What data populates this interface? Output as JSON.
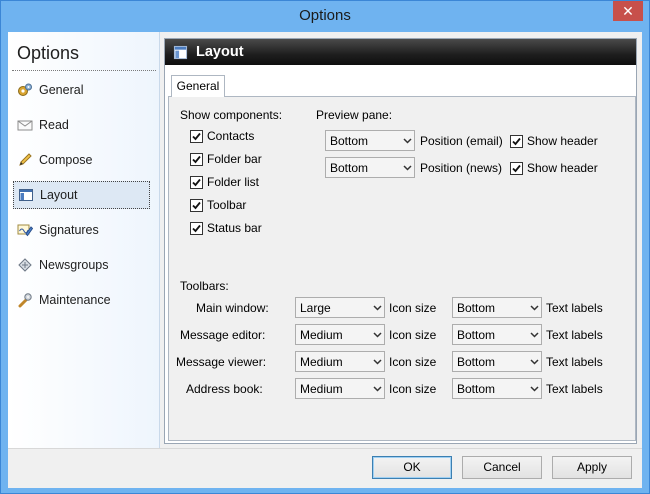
{
  "window": {
    "title": "Options",
    "close_glyph": "✕"
  },
  "sidebar": {
    "title": "Options",
    "items": [
      {
        "label": "General",
        "icon": "gears-icon"
      },
      {
        "label": "Read",
        "icon": "envelope-icon"
      },
      {
        "label": "Compose",
        "icon": "pencil-icon"
      },
      {
        "label": "Layout",
        "icon": "layout-icon",
        "selected": true
      },
      {
        "label": "Signatures",
        "icon": "signature-icon"
      },
      {
        "label": "Newsgroups",
        "icon": "newsgroups-icon"
      },
      {
        "label": "Maintenance",
        "icon": "wrench-icon"
      }
    ]
  },
  "panel": {
    "header": "Layout",
    "tab": "General",
    "show_components": {
      "label": "Show components:",
      "items": [
        {
          "label": "Contacts",
          "checked": true
        },
        {
          "label": "Folder bar",
          "checked": true
        },
        {
          "label": "Folder list",
          "checked": true
        },
        {
          "label": "Toolbar",
          "checked": true
        },
        {
          "label": "Status bar",
          "checked": true
        }
      ]
    },
    "preview_pane": {
      "label": "Preview pane:",
      "rows": [
        {
          "value": "Bottom",
          "position_label": "Position (email)",
          "show_header_label": "Show header",
          "show_header": true
        },
        {
          "value": "Bottom",
          "position_label": "Position (news)",
          "show_header_label": "Show header",
          "show_header": true
        }
      ]
    },
    "toolbars": {
      "label": "Toolbars:",
      "icon_size_label": "Icon size",
      "text_labels_label": "Text labels",
      "rows": [
        {
          "name": "Main window:",
          "icon_size": "Large",
          "text_labels": "Bottom"
        },
        {
          "name": "Message editor:",
          "icon_size": "Medium",
          "text_labels": "Bottom"
        },
        {
          "name": "Message viewer:",
          "icon_size": "Medium",
          "text_labels": "Bottom"
        },
        {
          "name": "Address book:",
          "icon_size": "Medium",
          "text_labels": "Bottom"
        }
      ]
    }
  },
  "buttons": {
    "ok": "OK",
    "cancel": "Cancel",
    "apply": "Apply"
  }
}
